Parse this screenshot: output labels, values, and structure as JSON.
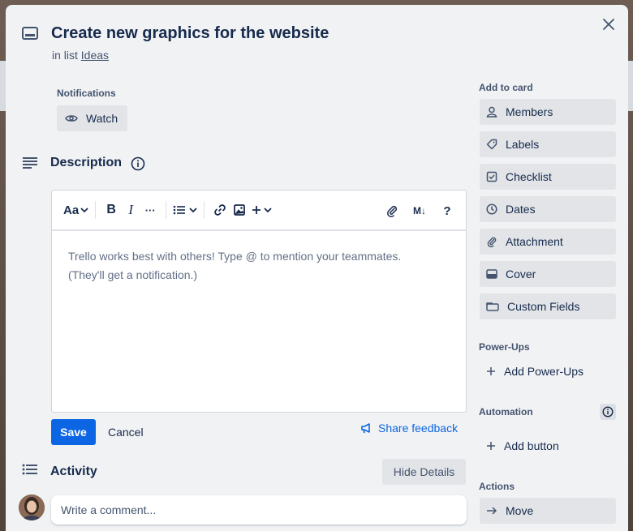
{
  "card": {
    "title": "Create new graphics for the website",
    "in_list_prefix": "in list",
    "list_name": "Ideas"
  },
  "notifications": {
    "label": "Notifications",
    "watch_label": "Watch"
  },
  "description": {
    "title": "Description",
    "placeholder_line1": "Trello works best with others! Type @ to mention your teammates.",
    "placeholder_line2": "(They'll get a notification.)",
    "toolbar": {
      "text_style": "Aa",
      "bold": "B",
      "italic": "I",
      "more": "···",
      "markdown": "M↓",
      "help": "?"
    },
    "save_label": "Save",
    "cancel_label": "Cancel",
    "share_feedback_label": "Share feedback"
  },
  "activity": {
    "title": "Activity",
    "hide_details_label": "Hide Details",
    "comment_placeholder": "Write a comment..."
  },
  "sidebar": {
    "add_to_card_label": "Add to card",
    "add_to_card": [
      {
        "label": "Members",
        "icon": "person-icon"
      },
      {
        "label": "Labels",
        "icon": "tag-icon"
      },
      {
        "label": "Checklist",
        "icon": "checkbox-icon"
      },
      {
        "label": "Dates",
        "icon": "clock-icon"
      },
      {
        "label": "Attachment",
        "icon": "paperclip-icon"
      },
      {
        "label": "Cover",
        "icon": "cover-icon"
      },
      {
        "label": "Custom Fields",
        "icon": "custom-fields-icon"
      }
    ],
    "power_ups_label": "Power-Ups",
    "add_power_ups": "Add Power-Ups",
    "automation_label": "Automation",
    "add_button": "Add button",
    "actions_label": "Actions",
    "move_label": "Move"
  },
  "colors": {
    "primary": "#0c66e4",
    "modal_bg": "#f1f2f4",
    "button_bg": "#e2e4e7",
    "text": "#172b4d"
  }
}
